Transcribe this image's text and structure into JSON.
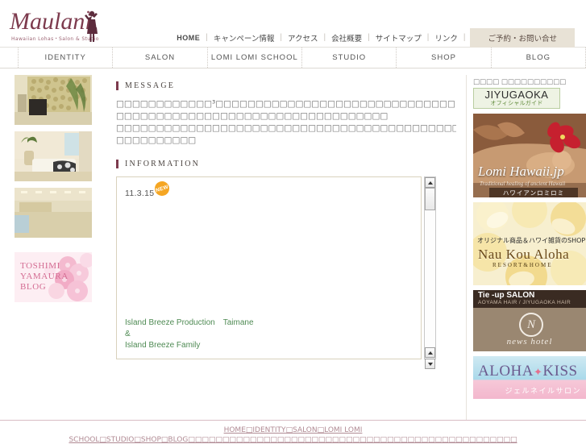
{
  "site": {
    "logo_word": "Maulani",
    "logo_tagline": "Hawaiian Lohas・Salon & Studio",
    "logo_icon": "hula-dancer-icon"
  },
  "topnav": {
    "items": [
      {
        "label": "HOME",
        "lang": "en"
      },
      {
        "label": "キャンペーン情報",
        "lang": "ja"
      },
      {
        "label": "アクセス",
        "lang": "ja"
      },
      {
        "label": "会社概要",
        "lang": "ja"
      },
      {
        "label": "サイトマップ",
        "lang": "ja"
      },
      {
        "label": "リンク",
        "lang": "ja"
      }
    ],
    "cta_label": "ご予約・お問い合せ",
    "separator": "|"
  },
  "mainnav": {
    "items": [
      {
        "label": "IDENTITY"
      },
      {
        "label": "SALON"
      },
      {
        "label": "LOMI LOMI SCHOOL"
      },
      {
        "label": "STUDIO"
      },
      {
        "label": "SHOP"
      },
      {
        "label": "BLOG"
      }
    ]
  },
  "left_sidebar": {
    "photos": [
      {
        "name": "salon-entrance-stone-wall-photo"
      },
      {
        "name": "treatment-room-photo"
      },
      {
        "name": "studio-interior-photo"
      }
    ],
    "blog_banner": {
      "line1": "TOSHIMI",
      "line2": "YAMAURA",
      "line3": "BLOG"
    }
  },
  "message": {
    "heading": "MESSAGE",
    "lines": [
      "□□□□□□□□□□□□³□□□□□□□□□□□□□□□□□□□□□□□□□□□□□□",
      "□□□□□□□□□□□□□□□□□□□□□□□□□□□□□□□□□□",
      "□□□□□□□□□□□□□□□□□□□□□□□□□□□□□□□□□□□□□□□□□□□□□□□□□□□□□□□□□□□□□□□□□□□□□□□□□□□□□□□□□□□□",
      "□□□□□□□□□□"
    ]
  },
  "information": {
    "heading": "INFORMATION",
    "date": "11.3.15",
    "badge": "NEW",
    "badge_color": "#f5a623",
    "body_lines": [
      "Island Breeze Production　Taimane",
      "&",
      "Island Breeze Family"
    ],
    "body_color": "#4e8a53"
  },
  "right_sidebar": {
    "heading": "□□□□ □□□□□□□□□□",
    "banners": [
      {
        "name": "jiyugaoka-official-guide-banner",
        "title": "JIYUGAOKA",
        "subtitle": "オフィシャルガイド"
      },
      {
        "name": "lomi-hawaii-jp-banner",
        "title": "Lomi Hawaii.jp",
        "subtitle": "Traditional healing of ancient Hawaii",
        "strip": "ハワイアンロミロミ"
      },
      {
        "name": "nau-kou-aloha-shop-banner",
        "tagline": "オリジナル商品＆ハワイ雑貨のSHOP",
        "brand": "Nau Kou Aloha",
        "subtitle": "RESORT&HOME"
      },
      {
        "name": "tie-up-salon-news-hotel-banner",
        "title": "Tie -up SALON",
        "subtitle": "AOYAMA HAIR / JIYUGAOKA HAIR",
        "brand": "news hotel",
        "mark": "N"
      },
      {
        "name": "aloha-kiss-nail-salon-banner",
        "title_a": "ALOHA",
        "title_dia": "✦",
        "title_b": "KISS",
        "subtitle": "ジェルネイルサロン"
      }
    ]
  },
  "footer": {
    "links": [
      "HOME",
      "IDENTITY",
      "SALON",
      "LOMI LOMI SCHOOL",
      "STUDIO",
      "SHOP",
      "BLOG"
    ],
    "separator": "□",
    "tail": "□□□□□□□□□□□□□□□□□□□□□□□□□□□□□□□□□□□□□□□□□□□□□□□□"
  },
  "scrollbars": {
    "info_scrollbar": "vertical",
    "arrow_up": "▲",
    "arrow_down": "▼"
  }
}
